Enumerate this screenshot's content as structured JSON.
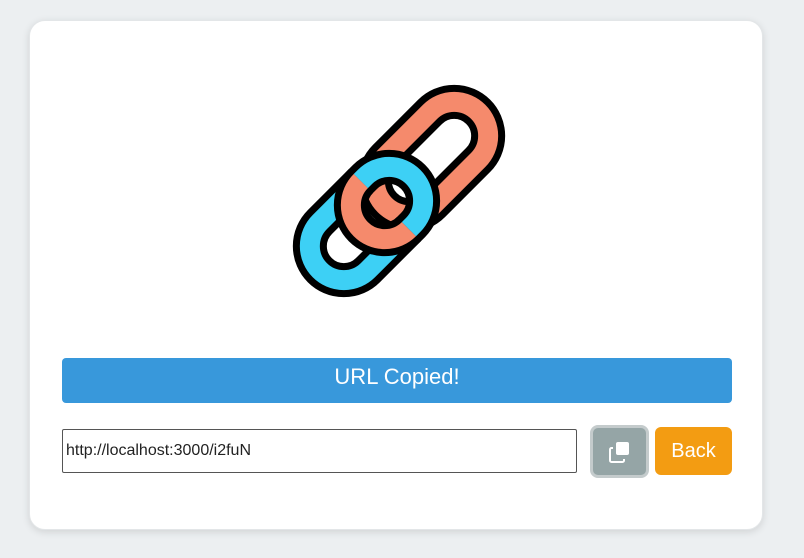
{
  "logo": {
    "icon": "chain-link-icon",
    "colors": {
      "upper_link": "#f58a6c",
      "lower_link": "#3dd0f5",
      "outline": "#000000"
    }
  },
  "banner": {
    "text": "URL Copied!",
    "color": "#3898db"
  },
  "url_field": {
    "value": "http://localhost:3000/i2fuN"
  },
  "copy_button": {
    "icon": "copy-icon",
    "color": "#95a5a6"
  },
  "back_button": {
    "label": "Back",
    "color": "#f39c12"
  }
}
